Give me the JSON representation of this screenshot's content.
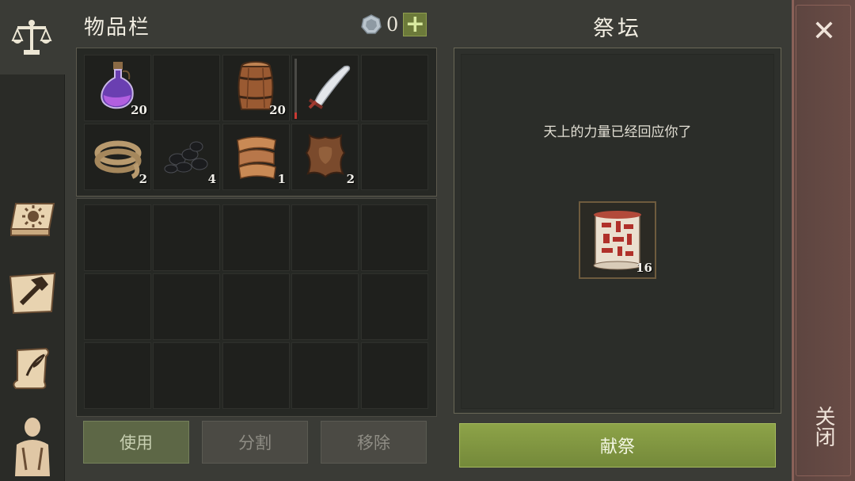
{
  "tabs": [
    {
      "name": "trade",
      "icon": "scales-icon",
      "active": true
    },
    {
      "name": "journal",
      "icon": "sun-book-icon",
      "active": false
    },
    {
      "name": "craft",
      "icon": "hammer-icon",
      "active": false
    },
    {
      "name": "quests",
      "icon": "scroll-quill-icon",
      "active": false
    },
    {
      "name": "character",
      "icon": "character-icon",
      "active": false
    }
  ],
  "inventory": {
    "title": "物品栏",
    "currency": {
      "icon": "silver-coin-icon",
      "value": "0",
      "add_label": "+"
    },
    "items": [
      {
        "slot": 0,
        "name": "potion-flask",
        "qty": "20"
      },
      {
        "slot": 1,
        "name": "",
        "qty": ""
      },
      {
        "slot": 2,
        "name": "barrel",
        "qty": "20"
      },
      {
        "slot": 3,
        "name": "scimitar",
        "qty": "",
        "durability": 0.1
      },
      {
        "slot": 4,
        "name": "",
        "qty": ""
      },
      {
        "slot": 5,
        "name": "rope",
        "qty": "2"
      },
      {
        "slot": 6,
        "name": "coal",
        "qty": "4"
      },
      {
        "slot": 7,
        "name": "cloth",
        "qty": "1"
      },
      {
        "slot": 8,
        "name": "leather-hide",
        "qty": "2"
      },
      {
        "slot": 9,
        "name": "",
        "qty": ""
      }
    ],
    "buttons": {
      "use": "使用",
      "split": "分割",
      "remove": "移除"
    }
  },
  "altar": {
    "title": "祭坛",
    "message": "天上的力量已经回应你了",
    "offering": {
      "name": "rune-scroll",
      "qty": "16"
    },
    "sacrifice_label": "献祭"
  },
  "close": {
    "icon": "close-icon",
    "label": "关闭"
  }
}
